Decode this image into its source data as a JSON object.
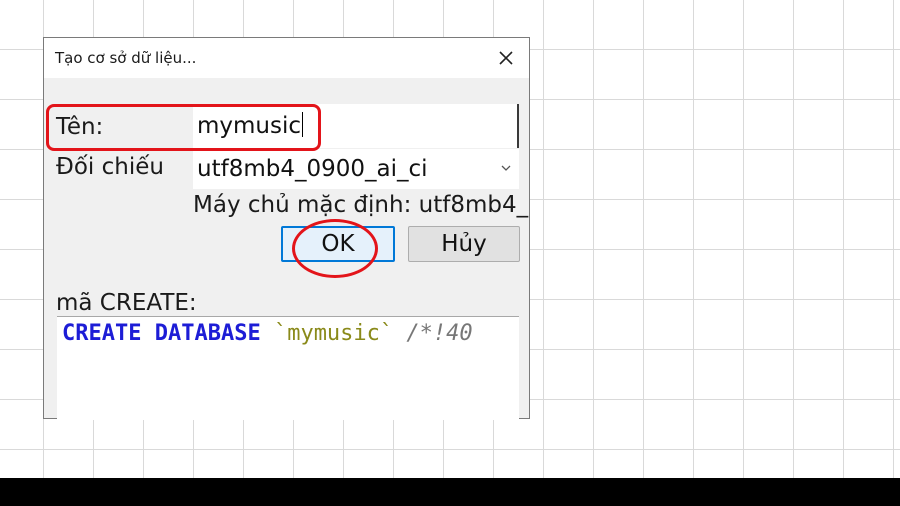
{
  "dialog": {
    "title": "Tạo cơ sở dữ liệu...",
    "close_icon": "close-icon"
  },
  "form": {
    "name_label": "Tên:",
    "name_value": "mymusic",
    "collation_label": "Đối chiếu",
    "collation_value": "utf8mb4_0900_ai_ci",
    "default_text": "Máy chủ mặc định: utf8mb4_"
  },
  "buttons": {
    "ok": "OK",
    "cancel": "Hủy"
  },
  "sql": {
    "label": "mã CREATE:",
    "kw_create": "CREATE",
    "kw_database": "DATABASE",
    "db_name": "`mymusic`",
    "comment": "/*!40"
  },
  "colors": {
    "highlight": "#e3141a",
    "ok_border": "#0078d7",
    "keyword": "#1d1dd6",
    "string": "#8a8a1a"
  }
}
